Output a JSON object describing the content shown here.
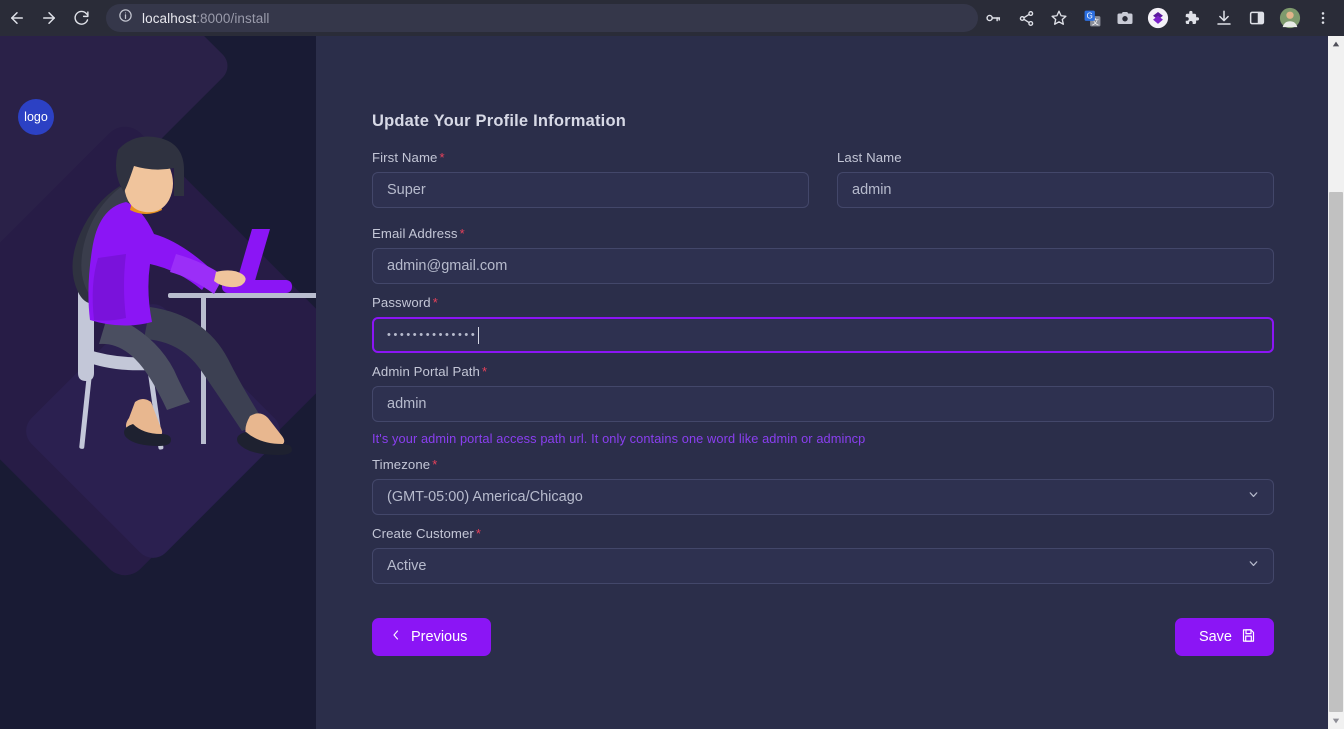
{
  "browser": {
    "url_host": "localhost",
    "url_path": ":8000/install",
    "back_icon": "back-arrow-icon",
    "forward_icon": "forward-arrow-icon",
    "reload_icon": "reload-icon",
    "info_icon": "site-info-icon",
    "toolbar_icons": [
      "password-key-icon",
      "share-icon",
      "bookmark-star-icon",
      "google-translate-icon",
      "screenshot-camera-icon",
      "purple-gem-extension-icon",
      "extensions-puzzle-icon",
      "downloads-icon",
      "side-panel-icon",
      "profile-avatar-icon",
      "browser-menu-icon"
    ]
  },
  "hero": {
    "logo_text": "logo",
    "illustration": "woman-working-on-laptop-illustration"
  },
  "form": {
    "title": "Update Your Profile Information",
    "required_mark": "*",
    "fields": {
      "first_name": {
        "label": "First Name",
        "value": "Super",
        "required": true
      },
      "last_name": {
        "label": "Last Name",
        "value": "admin",
        "required": false
      },
      "email": {
        "label": "Email Address",
        "value": "admin@gmail.com",
        "required": true
      },
      "password": {
        "label": "Password",
        "value": "••••••••••••••",
        "required": true,
        "focused": true
      },
      "admin_portal_path": {
        "label": "Admin Portal Path",
        "value": "admin",
        "required": true,
        "helper": "It's your admin portal access path url. It only contains one word like admin or admincp"
      },
      "timezone": {
        "label": "Timezone",
        "value": "(GMT-05:00) America/Chicago",
        "required": true
      },
      "create_customer": {
        "label": "Create Customer",
        "value": "Active",
        "required": true
      }
    },
    "buttons": {
      "previous": "Previous",
      "save": "Save"
    }
  },
  "colors": {
    "accent_purple": "#8b15f5",
    "required_red": "#e8415a",
    "panel_dark": "#191b34",
    "content_bg": "#2b2e4a",
    "input_bg": "#2e3150",
    "helper_purple": "#8a3ff0"
  }
}
